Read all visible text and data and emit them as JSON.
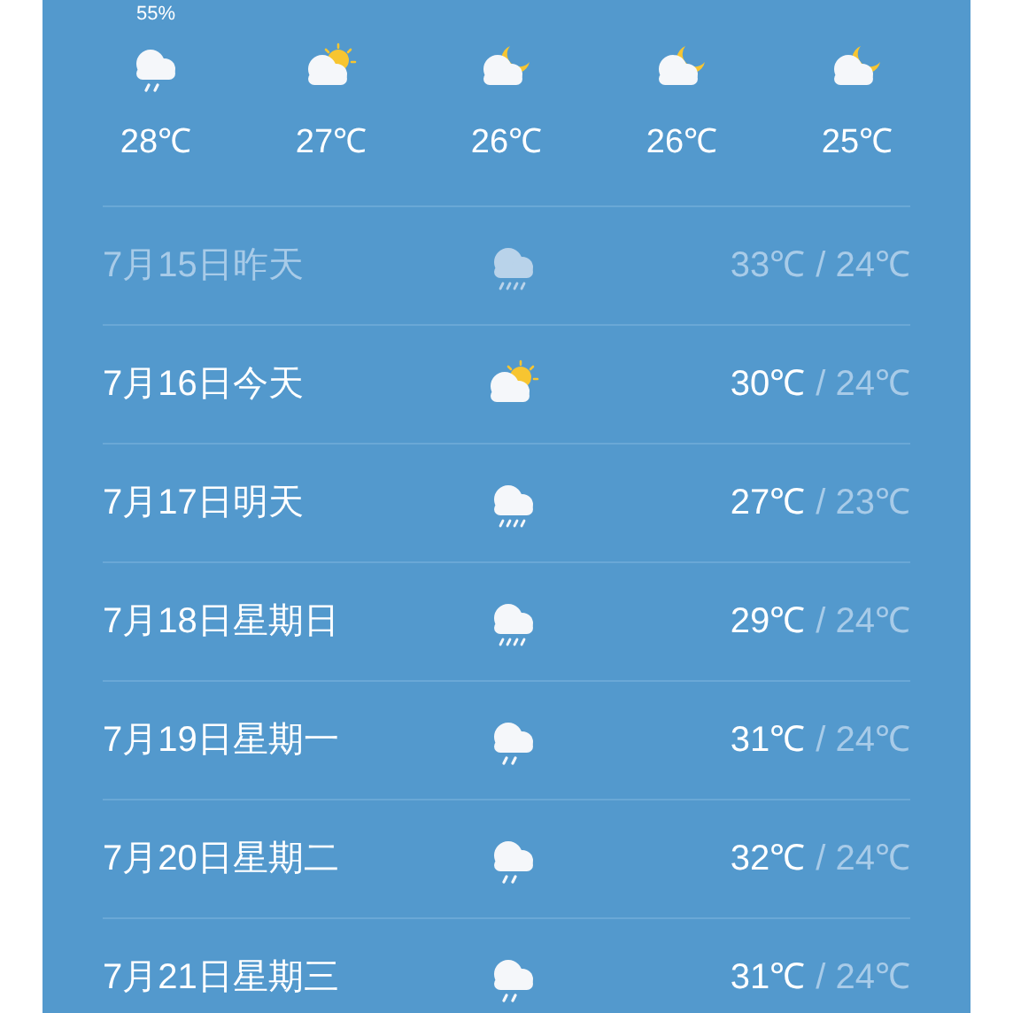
{
  "hourly": [
    {
      "precip": "55%",
      "kind": "rain_light",
      "temp": "28℃"
    },
    {
      "kind": "partly_sunny",
      "temp": "27℃"
    },
    {
      "kind": "night_cloudy",
      "temp": "26℃"
    },
    {
      "kind": "night_cloudy",
      "temp": "26℃"
    },
    {
      "kind": "night_cloudy",
      "temp": "25℃"
    }
  ],
  "daily": [
    {
      "date": "7月15日昨天",
      "kind": "rain_heavy",
      "high": "33℃",
      "low": "/ 24℃",
      "past": true
    },
    {
      "date": "7月16日今天",
      "kind": "partly_sunny",
      "high": "30℃",
      "low": "/ 24℃",
      "past": false
    },
    {
      "date": "7月17日明天",
      "kind": "rain_heavy",
      "high": "27℃",
      "low": "/ 23℃",
      "past": false
    },
    {
      "date": "7月18日星期日",
      "kind": "rain_heavy",
      "high": "29℃",
      "low": "/ 24℃",
      "past": false
    },
    {
      "date": "7月19日星期一",
      "kind": "rain_light",
      "high": "31℃",
      "low": "/ 24℃",
      "past": false
    },
    {
      "date": "7月20日星期二",
      "kind": "rain_light",
      "high": "32℃",
      "low": "/ 24℃",
      "past": false
    },
    {
      "date": "7月21日星期三",
      "kind": "rain_light",
      "high": "31℃",
      "low": "/ 24℃",
      "past": false
    }
  ]
}
